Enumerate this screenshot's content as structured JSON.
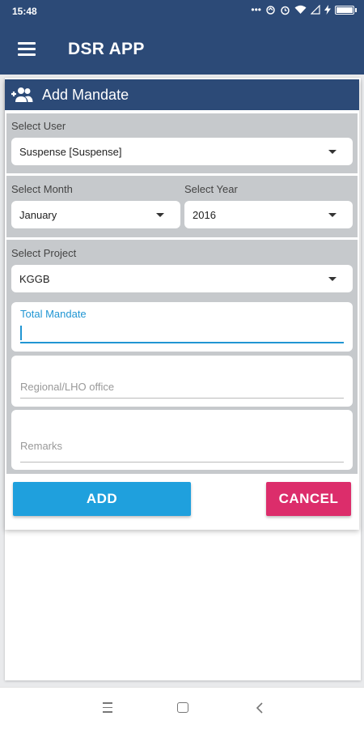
{
  "status_bar": {
    "time": "15:48",
    "icons": [
      "more-dots-icon",
      "sync-icon",
      "alarm-icon",
      "wifi-icon",
      "signal-icon",
      "charging-icon",
      "battery-icon"
    ]
  },
  "app_bar": {
    "title": "DSR APP",
    "menu_icon": "hamburger-icon"
  },
  "card": {
    "title": "Add Mandate",
    "icon": "add-group-icon",
    "select_user": {
      "label": "Select User",
      "value": "Suspense [Suspense]"
    },
    "select_month": {
      "label": "Select Month",
      "value": "January"
    },
    "select_year": {
      "label": "Select Year",
      "value": "2016"
    },
    "select_project": {
      "label": "Select Project",
      "value": "KGGB"
    },
    "total_mandate": {
      "label": "Total Mandate",
      "value": ""
    },
    "regional_office": {
      "label": "Regional/LHO office",
      "value": ""
    },
    "remarks": {
      "label": "Remarks",
      "value": ""
    },
    "add_button": "ADD",
    "cancel_button": "CANCEL"
  },
  "colors": {
    "primary": "#2c4a77",
    "accent_blue": "#1fa0dd",
    "focus_blue": "#2196d3",
    "cancel_pink": "#dc2d6b",
    "section_gray": "#c6c9cc"
  },
  "nav_bar": {
    "icons": [
      "recent-apps-icon",
      "home-icon",
      "back-icon"
    ]
  }
}
